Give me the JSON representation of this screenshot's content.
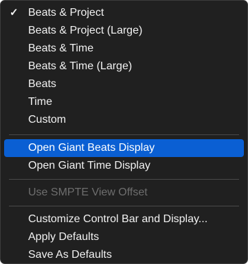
{
  "menu": {
    "display_group": [
      {
        "label": "Beats & Project",
        "checked": true
      },
      {
        "label": "Beats & Project (Large)",
        "checked": false
      },
      {
        "label": "Beats & Time",
        "checked": false
      },
      {
        "label": "Beats & Time (Large)",
        "checked": false
      },
      {
        "label": "Beats",
        "checked": false
      },
      {
        "label": "Time",
        "checked": false
      },
      {
        "label": "Custom",
        "checked": false
      }
    ],
    "giant_group": [
      {
        "label": "Open Giant Beats Display",
        "highlighted": true
      },
      {
        "label": "Open Giant Time Display",
        "highlighted": false
      }
    ],
    "smpte_group": [
      {
        "label": "Use SMPTE View Offset",
        "enabled": false
      }
    ],
    "defaults_group": [
      {
        "label": "Customize Control Bar and Display..."
      },
      {
        "label": "Apply Defaults"
      },
      {
        "label": "Save As Defaults"
      }
    ],
    "check_glyph": "✓",
    "colors": {
      "background": "#202020",
      "highlight": "#0a5fd3",
      "text": "#f2f2f2",
      "disabled_text": "#6e6e6e",
      "separator": "#4a4a4a"
    }
  }
}
